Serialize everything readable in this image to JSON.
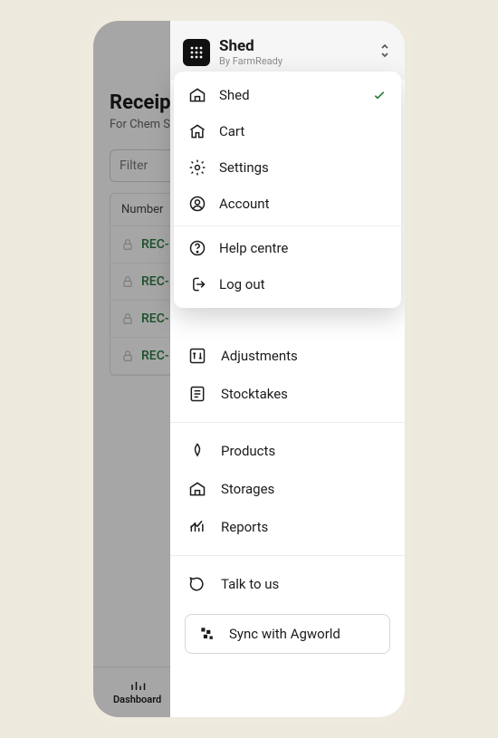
{
  "page": {
    "title": "Receipts",
    "subtitle": "For Chem Shed",
    "filter_label": "Filter",
    "table_header": "Number",
    "rows": [
      "REC-",
      "REC-",
      "REC-",
      "REC-"
    ]
  },
  "drawer": {
    "app_name": "Shed",
    "app_sub": "By FarmReady",
    "dropdown": {
      "items": [
        {
          "label": "Shed",
          "selected": true
        },
        {
          "label": "Cart",
          "selected": false
        },
        {
          "label": "Settings",
          "selected": false
        },
        {
          "label": "Account",
          "selected": false
        }
      ],
      "footer_items": [
        {
          "label": "Help centre"
        },
        {
          "label": "Log out"
        }
      ]
    },
    "nav": {
      "group1": [
        {
          "label": "Adjustments"
        },
        {
          "label": "Stocktakes"
        }
      ],
      "group2": [
        {
          "label": "Products"
        },
        {
          "label": "Storages"
        },
        {
          "label": "Reports"
        }
      ],
      "group3": [
        {
          "label": "Talk to us"
        }
      ],
      "sync_label": "Sync with Agworld"
    }
  },
  "bottom_nav": {
    "dashboard": "Dashboard"
  }
}
